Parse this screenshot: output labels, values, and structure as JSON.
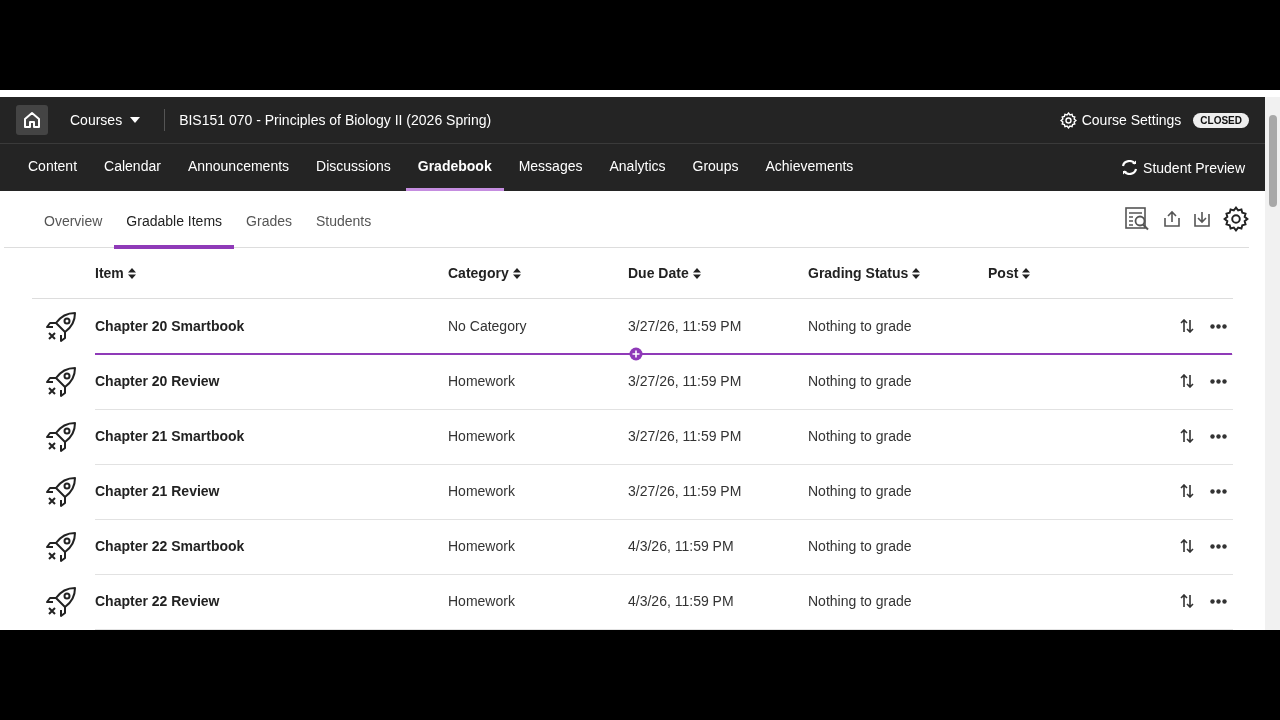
{
  "top_bar": {
    "courses_menu": "Courses",
    "course_title": "BIS151 070 - Principles of Biology II (2026 Spring)",
    "settings_label": "Course Settings",
    "status_badge": "CLOSED"
  },
  "nav": {
    "items": [
      {
        "label": "Content",
        "selected": false
      },
      {
        "label": "Calendar",
        "selected": false
      },
      {
        "label": "Announcements",
        "selected": false
      },
      {
        "label": "Discussions",
        "selected": false
      },
      {
        "label": "Gradebook",
        "selected": true
      },
      {
        "label": "Messages",
        "selected": false
      },
      {
        "label": "Analytics",
        "selected": false
      },
      {
        "label": "Groups",
        "selected": false
      },
      {
        "label": "Achievements",
        "selected": false
      }
    ],
    "student_preview": "Student Preview"
  },
  "subtabs": [
    {
      "label": "Overview",
      "selected": false
    },
    {
      "label": "Gradable Items",
      "selected": true
    },
    {
      "label": "Grades",
      "selected": false
    },
    {
      "label": "Students",
      "selected": false
    }
  ],
  "table": {
    "columns": [
      "Item",
      "Category",
      "Due Date",
      "Grading Status",
      "Post"
    ],
    "rows": [
      {
        "item": "Chapter 20 Smartbook",
        "category": "No Category",
        "due_date": "3/27/26, 11:59 PM",
        "grading_status": "Nothing to grade"
      },
      {
        "item": "Chapter 20 Review",
        "category": "Homework",
        "due_date": "3/27/26, 11:59 PM",
        "grading_status": "Nothing to grade"
      },
      {
        "item": "Chapter 21 Smartbook",
        "category": "Homework",
        "due_date": "3/27/26, 11:59 PM",
        "grading_status": "Nothing to grade"
      },
      {
        "item": "Chapter 21 Review",
        "category": "Homework",
        "due_date": "3/27/26, 11:59 PM",
        "grading_status": "Nothing to grade"
      },
      {
        "item": "Chapter 22 Smartbook",
        "category": "Homework",
        "due_date": "4/3/26, 11:59 PM",
        "grading_status": "Nothing to grade"
      },
      {
        "item": "Chapter 22 Review",
        "category": "Homework",
        "due_date": "4/3/26, 11:59 PM",
        "grading_status": "Nothing to grade"
      }
    ]
  }
}
